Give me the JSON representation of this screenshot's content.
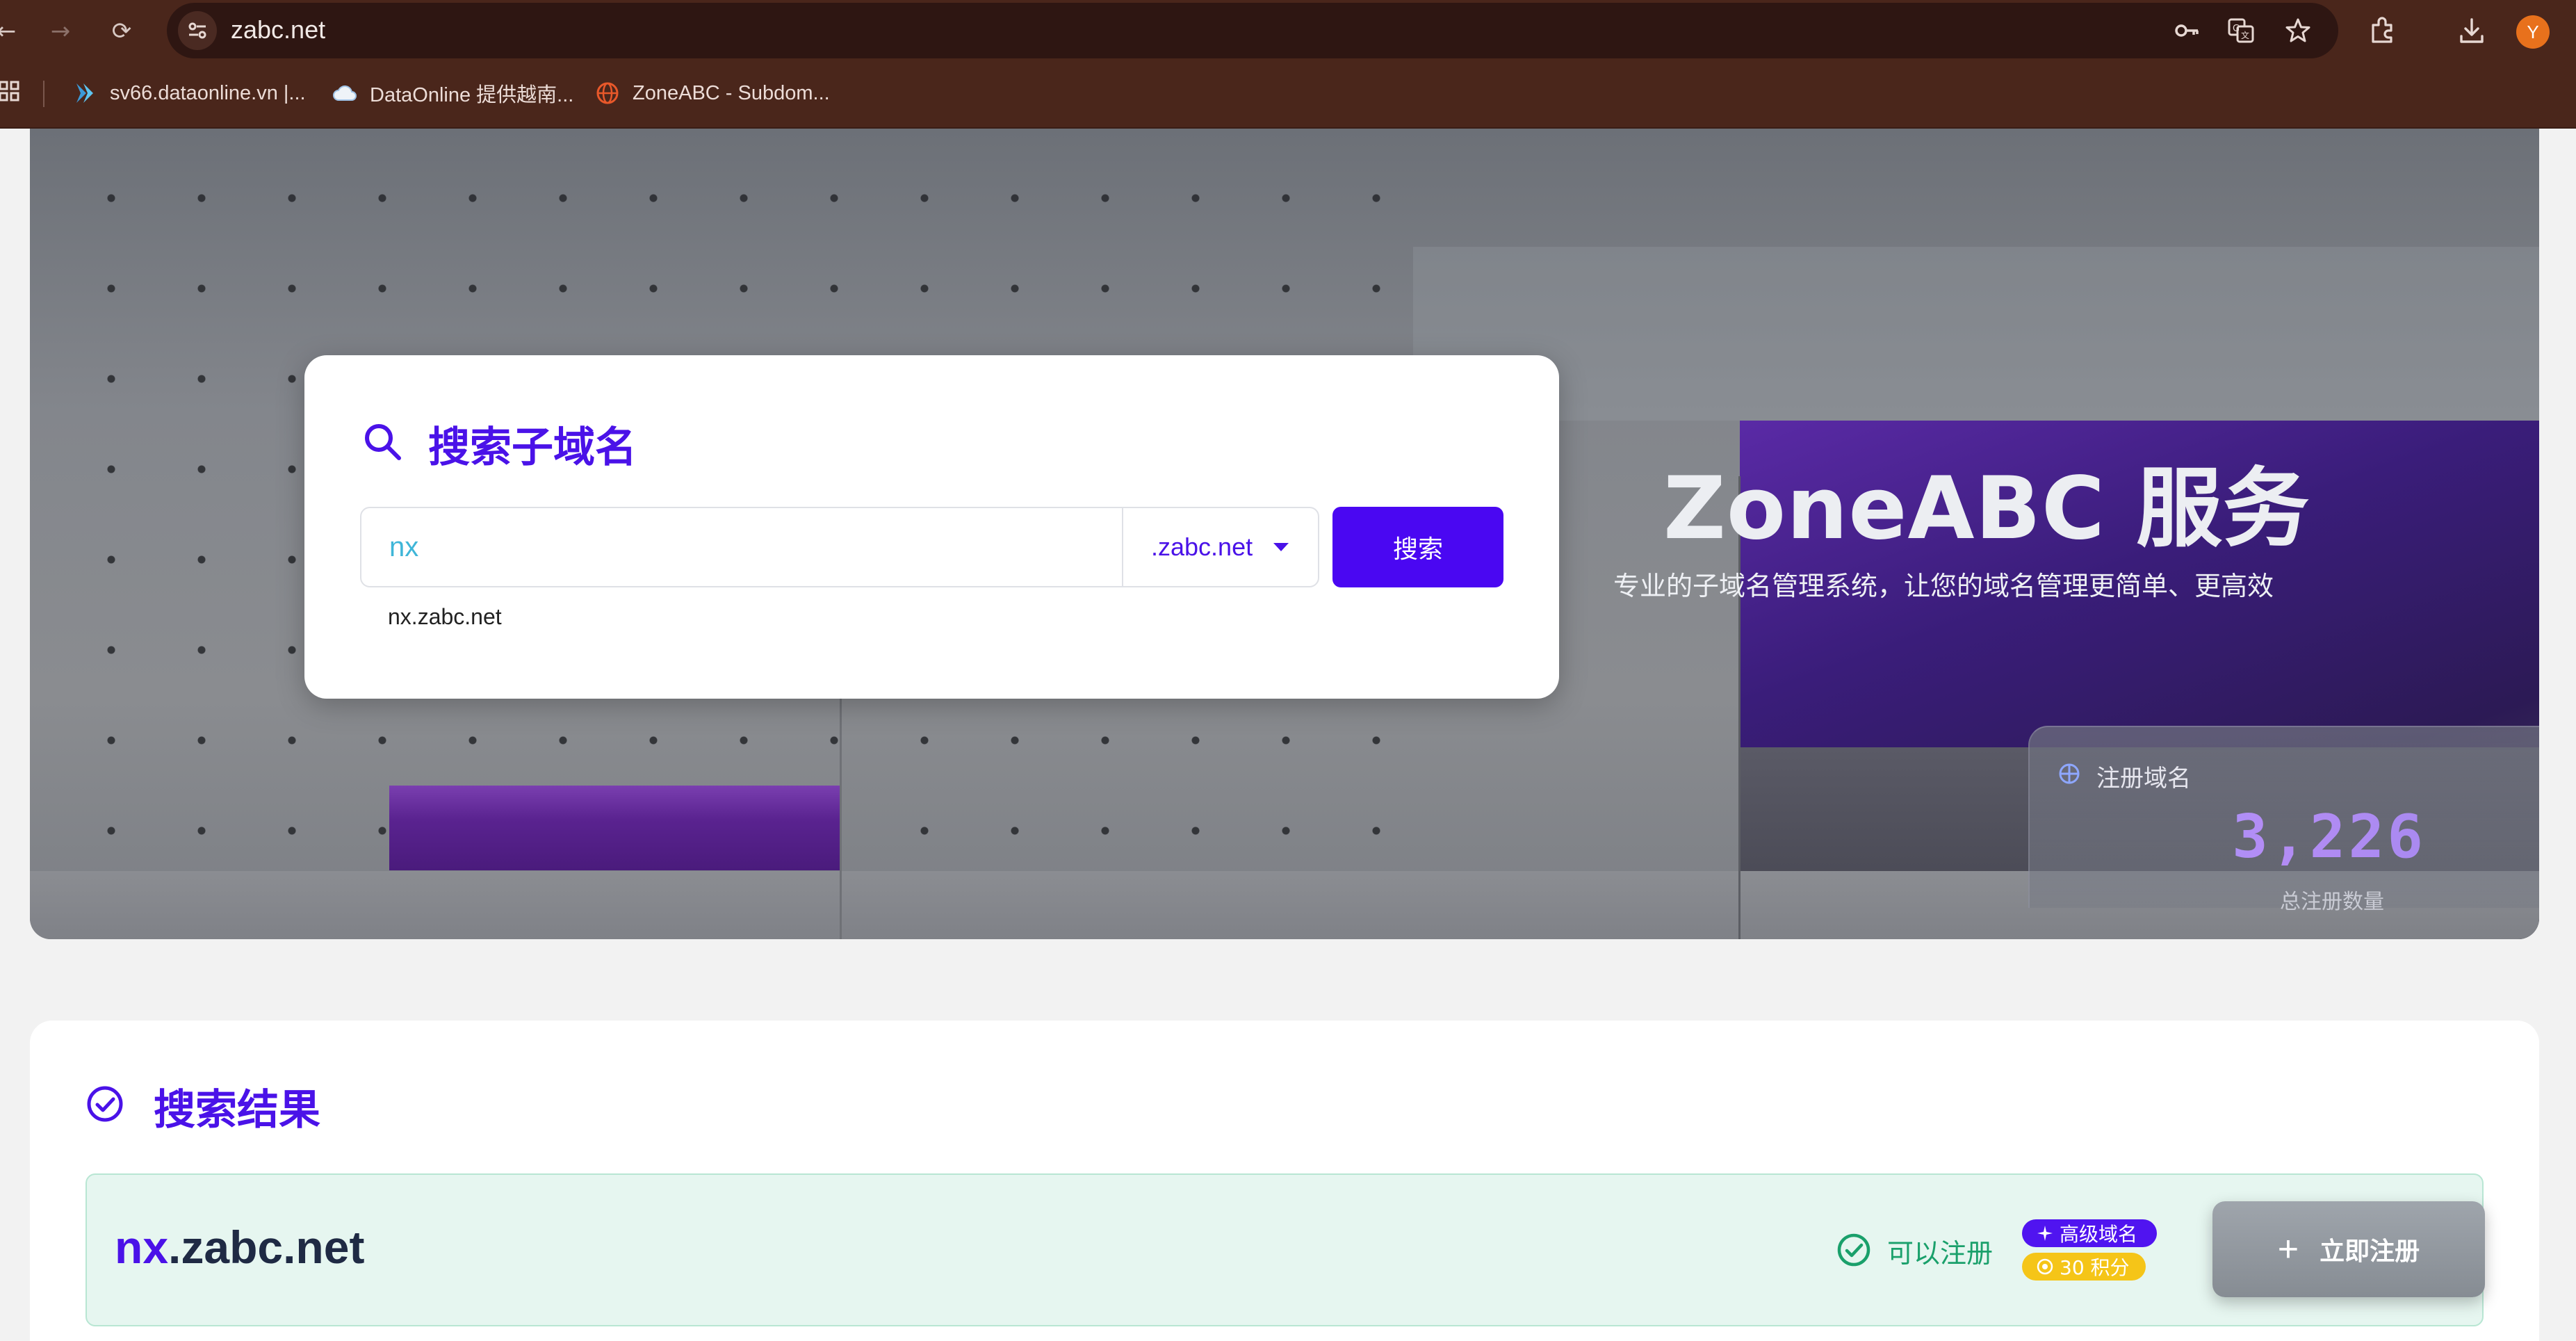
{
  "browser": {
    "url": "zabc.net",
    "avatar_letter": "Y",
    "bookmarks": [
      {
        "label": "sv66.dataonline.vn |...",
        "icon": "dataonline-icon"
      },
      {
        "label": "DataOnline 提供越南...",
        "icon": "cloud-icon"
      },
      {
        "label": "ZoneABC - Subdom...",
        "icon": "globe-icon"
      }
    ]
  },
  "search": {
    "title": "搜索子域名",
    "input_value": "nx",
    "suffix": ".zabc.net",
    "button_label": "搜索",
    "hint": "nx.zabc.net"
  },
  "hero": {
    "title": "ZoneABC 服务",
    "subtitle": "专业的子域名管理系统，让您的域名管理更简单、更高效",
    "stat": {
      "label": "注册域名",
      "value": "3,226",
      "caption": "总注册数量"
    }
  },
  "results": {
    "title": "搜索结果",
    "items": [
      {
        "name_highlight": "nx",
        "name_rest": ".zabc.net",
        "status": "可以注册",
        "badge_premium": "高级域名",
        "badge_points": "30 积分",
        "register_label": "立即注册"
      }
    ]
  },
  "colors": {
    "accent": "#4a12e8",
    "success": "#1aa06b",
    "chrome": "#4a261b",
    "points": "#f5c518"
  }
}
